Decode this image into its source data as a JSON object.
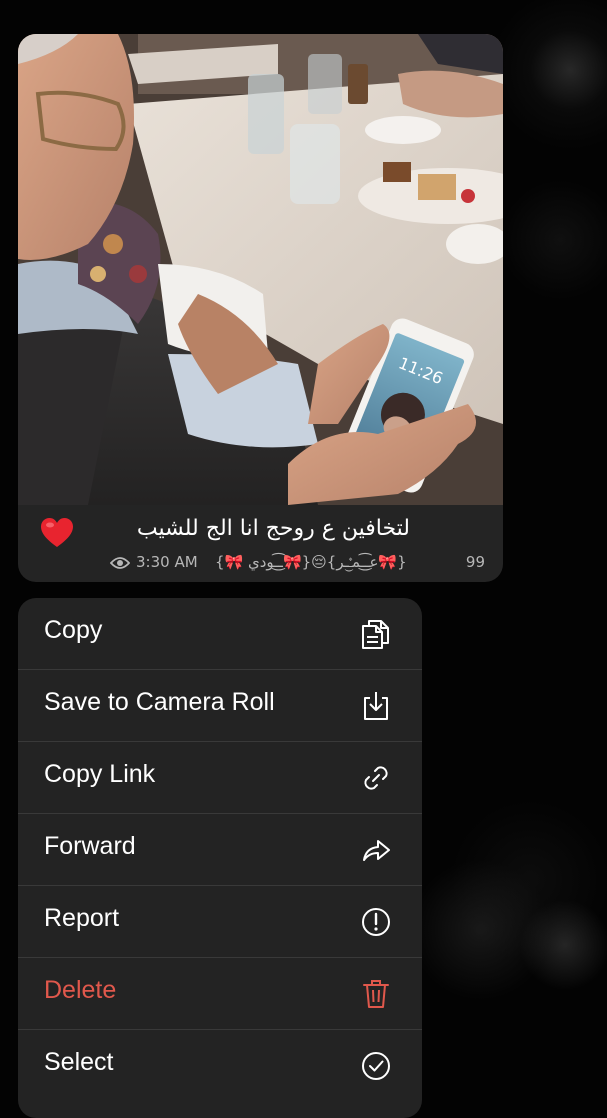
{
  "message": {
    "caption": "لتخافين ع روحج انا الج للشيب",
    "caption_emoji_icon": "red-heart-icon",
    "views": "99",
    "author": "{🎀عـ͜͡ـمـٰ۫͜ـر}😔{🎀ـ͜͡ـودي 🎀}",
    "time": "3:30 AM",
    "views_icon": "eye-icon",
    "photo_description_icons": "photo"
  },
  "menu": {
    "items": [
      {
        "label": "Copy",
        "icon": "copy-icon"
      },
      {
        "label": "Save to Camera Roll",
        "icon": "save-icon"
      },
      {
        "label": "Copy Link",
        "icon": "link-icon"
      },
      {
        "label": "Forward",
        "icon": "forward-icon"
      },
      {
        "label": "Report",
        "icon": "report-icon"
      },
      {
        "label": "Delete",
        "icon": "trash-icon"
      },
      {
        "label": "Select",
        "icon": "checkmark-circle-icon"
      }
    ]
  },
  "colors": {
    "background": "#030303",
    "bubble": "#242424",
    "menu": "#232323",
    "danger": "#e0584c",
    "meta_text": "#b7b7b7"
  }
}
